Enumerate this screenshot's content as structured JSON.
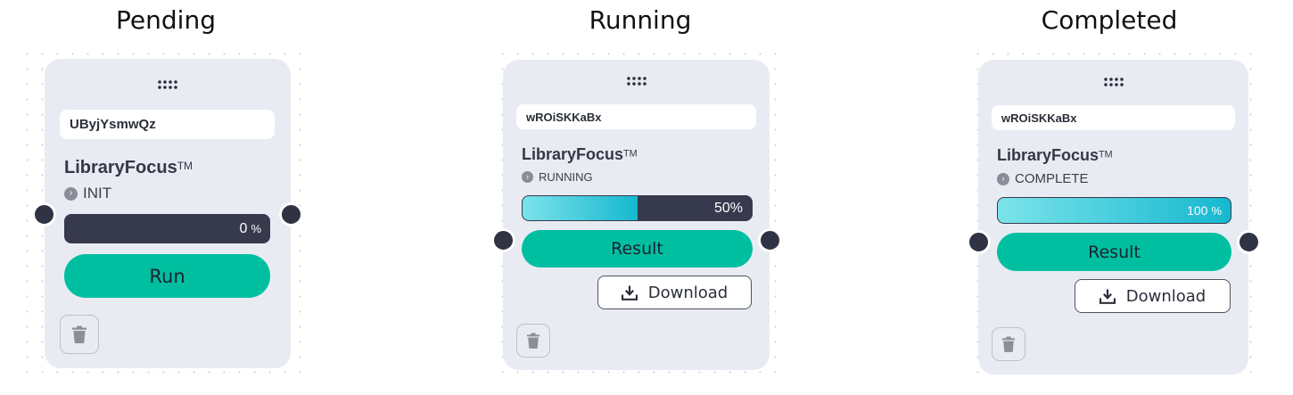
{
  "pending": {
    "state_title": "Pending",
    "id": "UByjYsmwQz",
    "name": "LibraryFocus",
    "trademark": "TM",
    "status": "INIT",
    "progress_value": 0,
    "progress_text": "0",
    "percent_sign": "%",
    "primary_button": "Run"
  },
  "running": {
    "state_title": "Running",
    "id": "wROiSKKaBx",
    "name": "LibraryFocus",
    "trademark": "TM",
    "status": "RUNNING",
    "progress_value": 50,
    "progress_text": "50%",
    "primary_button": "Result",
    "download_button": "Download"
  },
  "completed": {
    "state_title": "Completed",
    "id": "wROiSKKaBx",
    "name": "LibraryFocus",
    "trademark": "TM",
    "status": "COMPLETE",
    "progress_value": 100,
    "progress_text": "100",
    "percent_sign": "%",
    "primary_button": "Result",
    "download_button": "Download"
  },
  "colors": {
    "card_bg": "#e9ebf3",
    "accent": "#00bfa0",
    "progress_track": "#373a4c",
    "progress_fill_start": "#7be3ea",
    "progress_fill_end": "#16b8d0",
    "port": "#2f3343"
  },
  "icons": {
    "handle": "drag-handle-icon",
    "status": "chevron-right-circle-icon",
    "download": "download-icon",
    "trash": "trash-icon"
  }
}
